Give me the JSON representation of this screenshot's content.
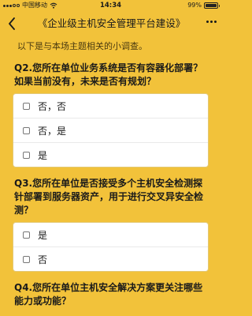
{
  "status_bar": {
    "carrier": "中国移动",
    "time": "14:34",
    "battery_percent": "99%",
    "battery_level": 0.99
  },
  "nav": {
    "title": "《企业级主机安全管理平台建设》"
  },
  "intro": "以下是与本场主题相关的小调查。",
  "questions": [
    {
      "text": "Q2.您所在单位业务系统是否有容器化部署？如果当前没有，未来是否有规划？",
      "options": [
        "否，否",
        "否，是",
        "是"
      ]
    },
    {
      "text": "Q3.您所在单位是否接受多个主机安全检测探针部署到服务器资产，用于进行交叉异安全检测？",
      "options": [
        "是",
        "否"
      ]
    },
    {
      "text": "Q4.您所在单位主机安全解决方案更关注哪些能力或功能？",
      "options": []
    }
  ],
  "colors": {
    "background": "#f2c23a",
    "card": "#ffffff"
  }
}
